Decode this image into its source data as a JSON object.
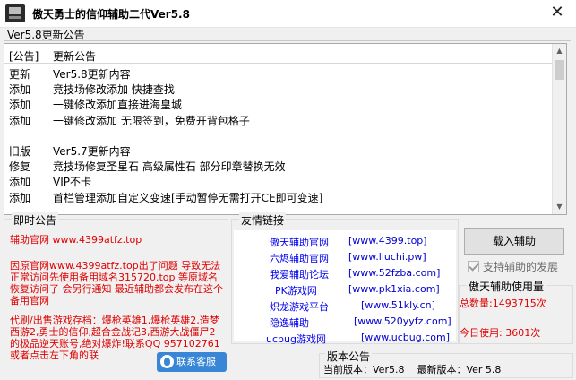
{
  "window": {
    "title": "傲天勇士的信仰辅助二代Ver5.8",
    "close_glyph": "✕"
  },
  "tab": {
    "label": "Ver5.8更新公告"
  },
  "update_list": {
    "header": {
      "col_a": "[公告]",
      "col_b": "更新公告"
    },
    "rows": [
      {
        "a": "更新",
        "b": "Ver5.8更新内容"
      },
      {
        "a": "添加",
        "b": "竞技场修改添加 快捷查找"
      },
      {
        "a": "添加",
        "b": "一键修改添加直接进海皇城"
      },
      {
        "a": "添加",
        "b": "一键修改添加 无限签到，免费开背包格子"
      },
      {
        "a": "",
        "b": ""
      },
      {
        "a": "旧版",
        "b": "Ver5.7更新内容"
      },
      {
        "a": "修复",
        "b": "竞技场修复圣星石 高级属性石 部分印章替换无效"
      },
      {
        "a": "添加",
        "b": "VIP不卡"
      },
      {
        "a": "添加",
        "b": "首栏管理添加自定义变速[手动暂停无需打开CE即可变速]"
      }
    ]
  },
  "notice": {
    "legend": "即时公告",
    "official": "辅助官网 www.4399atfz.top",
    "p1": "因原官网www.4399atfz.top出了问题 导致无法正常访问先使用备用域名315720.top 等原域名恢复访问了 会另行通知 最近辅助都会发布在这个备用官网",
    "p2": "代刷/出售游戏存档：爆枪英雄1,爆枪英雄2,造梦西游2,勇士的信仰,超合金战记3,西游大战僵尸2的极品逆天账号,绝对爆炸!联系QQ 957102761或者点击左下角的联",
    "contact_button": "联系客服"
  },
  "links": {
    "legend": "友情链接",
    "items": [
      {
        "name": "傲天辅助官网",
        "url": "[www.4399.top]"
      },
      {
        "name": "六烬辅助官网",
        "url": "[www.liuchi.pw]"
      },
      {
        "name": "我爱辅助论坛",
        "url": "[www.52fzba.com]"
      },
      {
        "name": "PK游戏网",
        "url": "[www.pk1xia.com]"
      },
      {
        "name": "炽龙游戏平台",
        "url": "[www.51kly.cn]"
      },
      {
        "name": "隐逸辅助",
        "url": "[www.520yyfz.com]"
      },
      {
        "name": "ucbug游戏网",
        "url": "[www.ucbug.com]"
      }
    ]
  },
  "actions": {
    "load_button": "载入辅助",
    "support_checkbox": "支持辅助的发展"
  },
  "usage": {
    "legend": "傲天辅助使用量",
    "total": "总数量:1493715次",
    "today": "今日使用: 3601次"
  },
  "version": {
    "legend": "版本公告",
    "current": "当前版本：Ver5.8",
    "latest": "最新版本：Ver 5.8"
  },
  "colors": {
    "accent_red": "#e00000",
    "link_blue": "#0000ee",
    "contact_button": "#3a86d6"
  }
}
